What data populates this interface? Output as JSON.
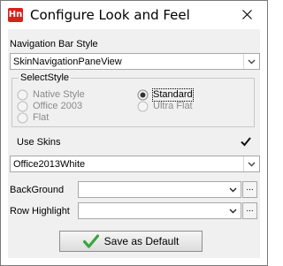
{
  "window": {
    "title": "Configure Look and Feel",
    "icon_text": "Hn",
    "icon_color": "#d9201c"
  },
  "navigation": {
    "label": "Navigation Bar Style",
    "value": "SkinNavigationPaneView"
  },
  "select_style": {
    "legend": "SelectStyle",
    "options": [
      {
        "label": "Native Style",
        "selected": false,
        "enabled": false
      },
      {
        "label": "Office 2003",
        "selected": false,
        "enabled": false
      },
      {
        "label": "Flat",
        "selected": false,
        "enabled": false
      },
      {
        "label": "Standard",
        "selected": true,
        "enabled": false
      },
      {
        "label": "Ultra Flat",
        "selected": false,
        "enabled": false
      }
    ]
  },
  "skins": {
    "label": "Use Skins",
    "checked": true,
    "value": "Office2013White"
  },
  "background": {
    "label": "BackGround",
    "value": "",
    "ellipsis": "..."
  },
  "row_highlight": {
    "label": "Row Highlight",
    "value": "",
    "ellipsis": "..."
  },
  "save_button": {
    "label": "Save as Default",
    "icon": "green-checkmark-icon",
    "icon_color": "#3aa63a"
  }
}
